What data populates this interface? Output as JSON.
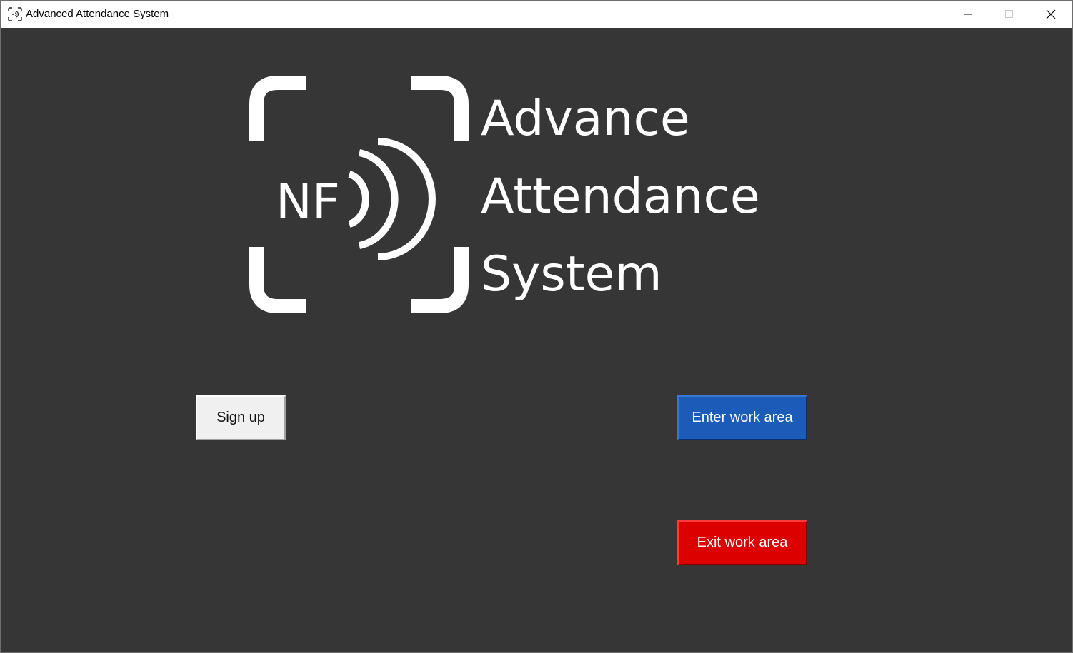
{
  "window": {
    "title": "Advanced Attendance System",
    "controls": {
      "minimize": "minimize-icon",
      "maximize": "maximize-icon",
      "close": "close-icon"
    }
  },
  "logo": {
    "badge_text": "NF",
    "line1": "Advance",
    "line2": "Attendance",
    "line3": "System"
  },
  "buttons": {
    "signup": "Sign up",
    "enter": "Enter work area",
    "exit": "Exit work area"
  },
  "colors": {
    "background": "#363636",
    "enter_button": "#1c5bb8",
    "exit_button": "#dd0000",
    "signup_button": "#f0f0f0"
  }
}
